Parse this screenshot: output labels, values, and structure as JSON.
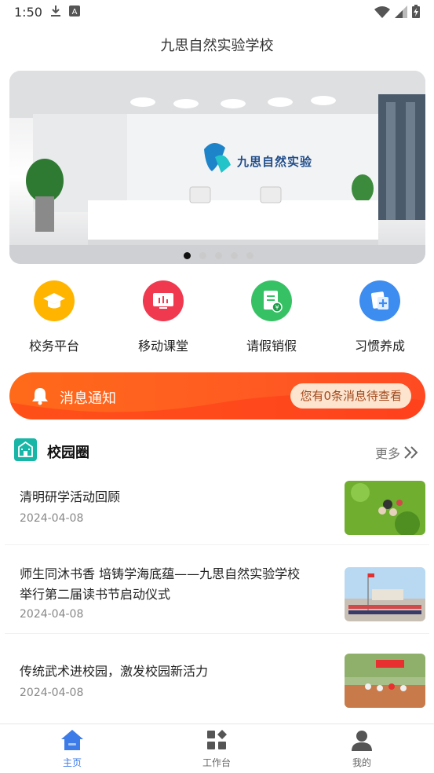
{
  "status_bar": {
    "time": "1:50"
  },
  "header": {
    "title": "九思自然实验学校"
  },
  "banner": {
    "logo_text": "九思自然实验"
  },
  "quick_menu": [
    {
      "label": "校务平台",
      "icon": "graduation-cap-icon",
      "color": "#ffb400"
    },
    {
      "label": "移动课堂",
      "icon": "monitor-icon",
      "color": "#f0384f"
    },
    {
      "label": "请假销假",
      "icon": "leave-form-icon",
      "color": "#36c264"
    },
    {
      "label": "习惯养成",
      "icon": "habit-add-icon",
      "color": "#3d8cf0"
    }
  ],
  "notice": {
    "label": "消息通知",
    "button": "您有0条消息待查看",
    "color": "#ff5a22"
  },
  "campus_section": {
    "title": "校园圈",
    "more": "更多"
  },
  "news": [
    {
      "title": "清明研学活动回顾",
      "date": "2024-04-08"
    },
    {
      "title": "师生同沐书香 培铸学海底蕴——九思自然实验学校举行第二届读书节启动仪式",
      "date": "2024-04-08"
    },
    {
      "title": "传统武术进校园，激发校园新活力",
      "date": "2024-04-08"
    }
  ],
  "bottom_nav": [
    {
      "label": "主页",
      "icon": "home-icon",
      "active": true
    },
    {
      "label": "工作台",
      "icon": "workbench-icon",
      "active": false
    },
    {
      "label": "我的",
      "icon": "profile-icon",
      "active": false
    }
  ],
  "colors": {
    "accent": "#3d7be8",
    "teal": "#18b6a6"
  }
}
